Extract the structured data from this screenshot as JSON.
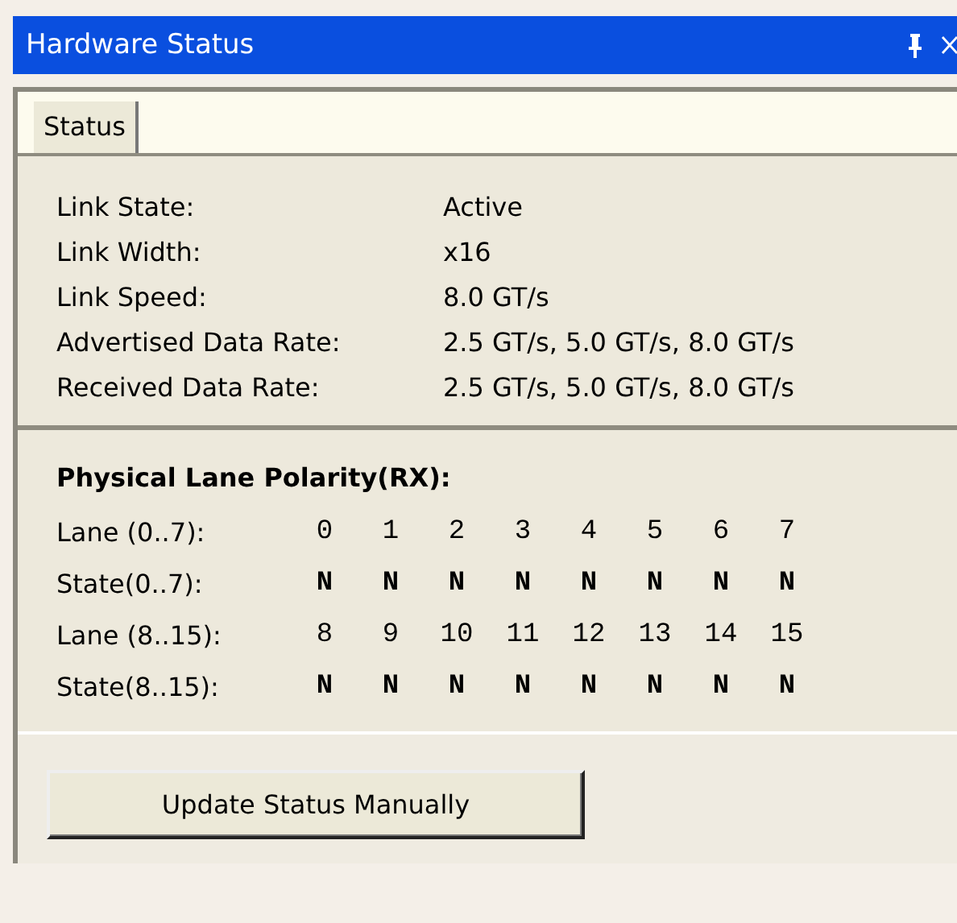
{
  "window": {
    "title": "Hardware Status"
  },
  "tabs": [
    {
      "label": "Status",
      "selected": true
    }
  ],
  "link_info": [
    {
      "label": "Link State:",
      "value": "Active"
    },
    {
      "label": "Link Width:",
      "value": "x16"
    },
    {
      "label": "Link Speed:",
      "value": "8.0 GT/s"
    },
    {
      "label": "Advertised Data Rate:",
      "value": "2.5 GT/s, 5.0 GT/s, 8.0 GT/s"
    },
    {
      "label": "Received Data Rate:",
      "value": "2.5 GT/s, 5.0 GT/s, 8.0 GT/s"
    }
  ],
  "polarity": {
    "title": "Physical Lane Polarity(RX):",
    "rows": [
      {
        "kind": "lane",
        "label": "Lane (0..7):",
        "values": [
          "0",
          "1",
          "2",
          "3",
          "4",
          "5",
          "6",
          "7"
        ]
      },
      {
        "kind": "state",
        "label": "State(0..7):",
        "values": [
          "N",
          "N",
          "N",
          "N",
          "N",
          "N",
          "N",
          "N"
        ]
      },
      {
        "kind": "lane",
        "label": "Lane (8..15):",
        "values": [
          "8",
          "9",
          "10",
          "11",
          "12",
          "13",
          "14",
          "15"
        ]
      },
      {
        "kind": "state",
        "label": "State(8..15):",
        "values": [
          "N",
          "N",
          "N",
          "N",
          "N",
          "N",
          "N",
          "N"
        ]
      }
    ]
  },
  "buttons": [
    "Update Status Manually"
  ]
}
